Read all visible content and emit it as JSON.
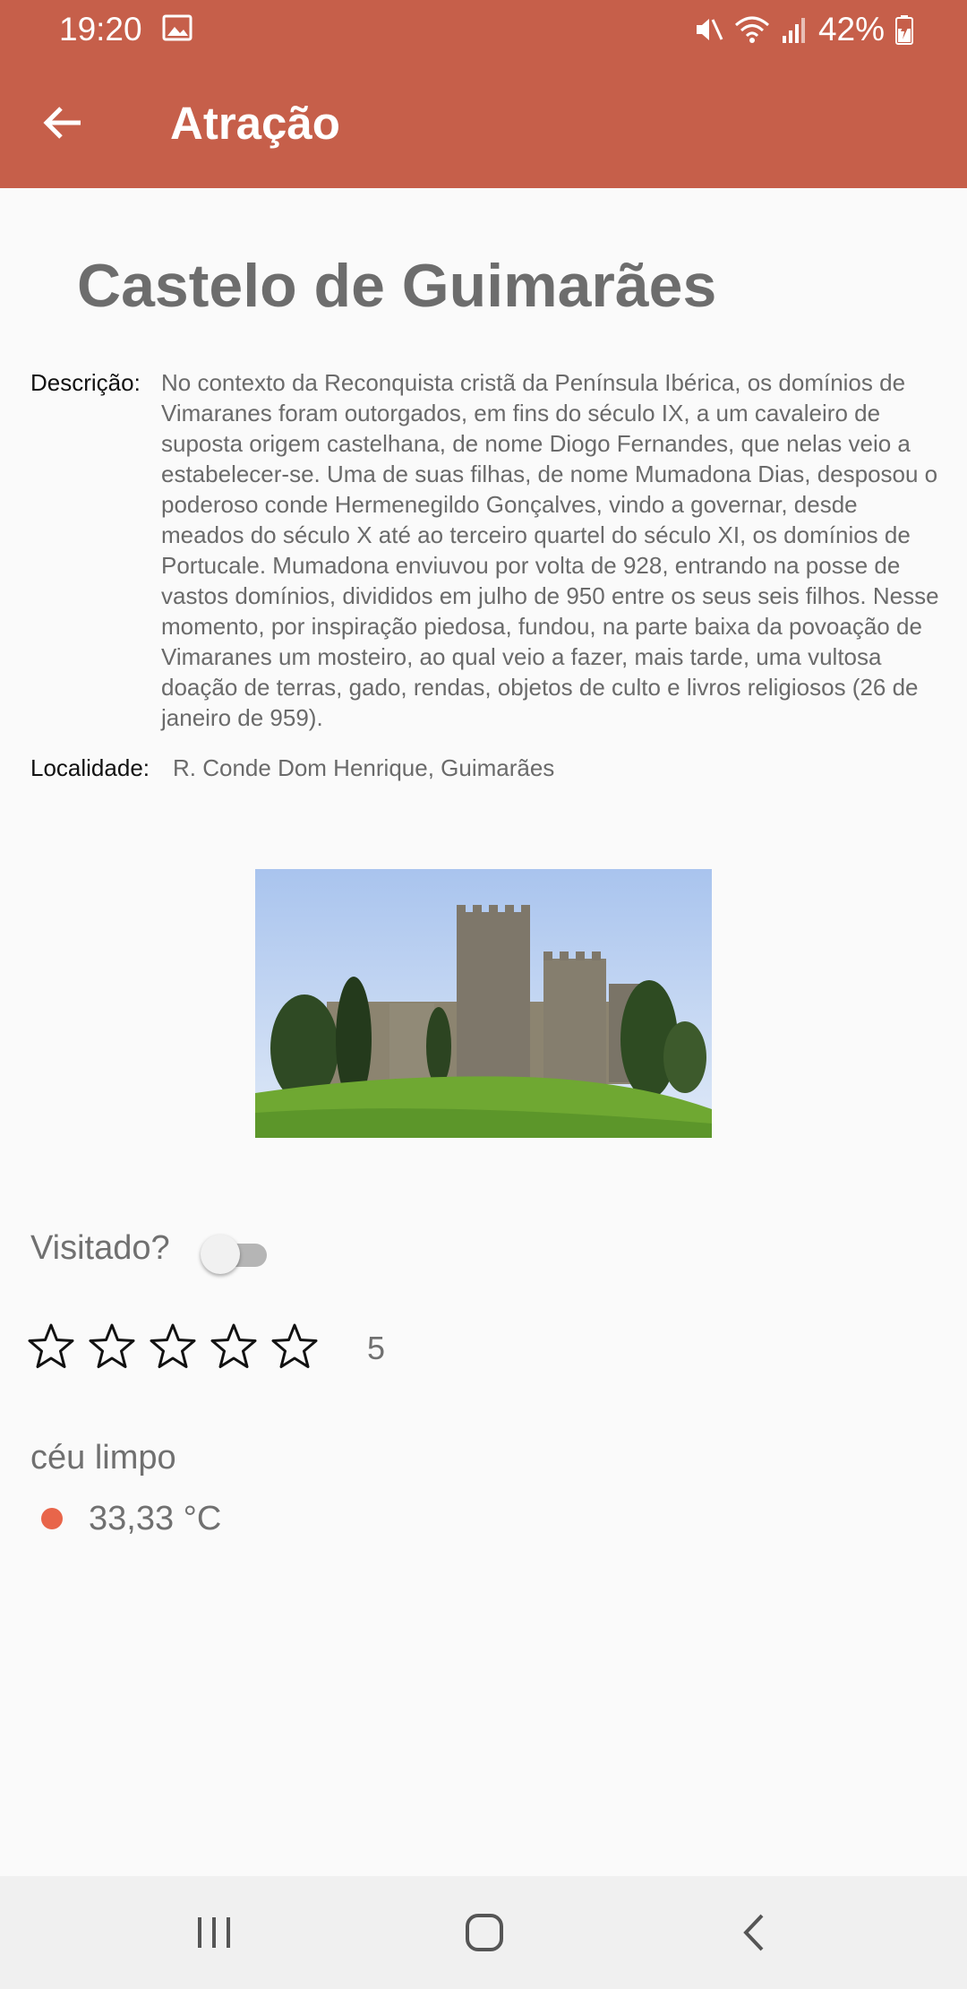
{
  "status_bar": {
    "time": "19:20",
    "battery": "42%",
    "icons": [
      "gallery-icon",
      "mute-icon",
      "wifi-icon",
      "signal-icon",
      "battery-icon"
    ]
  },
  "app_bar": {
    "title": "Atração",
    "back_icon": "arrow-left-icon"
  },
  "attraction": {
    "name": "Castelo de Guimarães",
    "description_label": "Descrição:",
    "description": "No contexto da Reconquista cristã da Península Ibérica, os domínios de Vimaranes foram outorgados, em fins do século IX, a um cavaleiro de suposta origem castelhana, de nome Diogo Fernandes, que nelas veio a estabelecer-se. Uma de suas filhas, de nome Mumadona Dias, desposou o poderoso conde Hermenegildo Gonçalves, vindo a governar, desde meados do século X até ao terceiro quartel do século XI, os domínios de Portucale. Mumadona enviuvou por volta de 928, entrando na posse de vastos domínios, divididos em julho de 950 entre os seus seis filhos. Nesse momento, por inspiração piedosa, fundou, na parte baixa da povoação de Vimaranes um mosteiro, ao qual veio a fazer, mais tarde, uma vultosa doação de terras, gado, rendas, objetos de culto e livros religiosos (26 de janeiro de 959).",
    "location_label": "Localidade:",
    "location": "R. Conde Dom Henrique, Guimarães"
  },
  "visited": {
    "label": "Visitado?",
    "checked": false
  },
  "rating": {
    "stars_total": 5,
    "stars_filled": 0,
    "value": "5"
  },
  "weather": {
    "description": "céu limpo",
    "temperature": "33,33 °C",
    "dot_color": "#e8654a"
  },
  "colors": {
    "primary": "#c65f4a",
    "accent": "#e8654a"
  },
  "nav_bar": {
    "icons": [
      "recent-apps-icon",
      "home-icon",
      "back-icon"
    ]
  }
}
